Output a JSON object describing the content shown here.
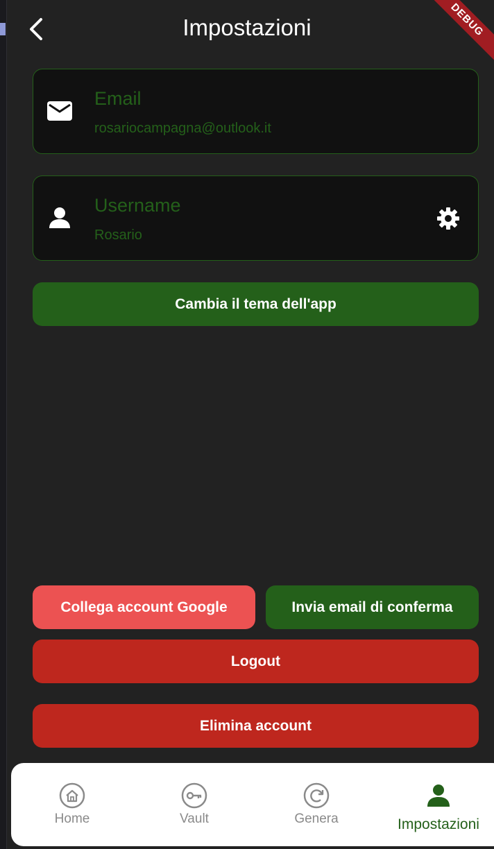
{
  "header": {
    "title": "Impostazioni",
    "debug_banner": "DEBUG"
  },
  "email_card": {
    "label": "Email",
    "value": "rosariocampagna@outlook.it",
    "icon": "mail-icon"
  },
  "username_card": {
    "label": "Username",
    "value": "Rosario",
    "icon": "person-icon",
    "action_icon": "gear-icon"
  },
  "buttons": {
    "change_theme": "Cambia il tema dell'app",
    "link_google": "Collega account Google",
    "send_confirmation": "Invia email di conferma",
    "logout": "Logout",
    "delete_account": "Elimina account"
  },
  "nav": {
    "items": [
      {
        "label": "Home",
        "icon": "home-icon",
        "active": false
      },
      {
        "label": "Vault",
        "icon": "key-icon",
        "active": false
      },
      {
        "label": "Genera",
        "icon": "refresh-icon",
        "active": false
      },
      {
        "label": "Impostazioni",
        "icon": "person-icon",
        "active": true
      }
    ]
  },
  "colors": {
    "background": "#222222",
    "card": "#111111",
    "accent_green": "#24601a",
    "google_pink": "#ec5252",
    "danger_red": "#be271e",
    "nav_inactive": "#8a8a8a"
  }
}
